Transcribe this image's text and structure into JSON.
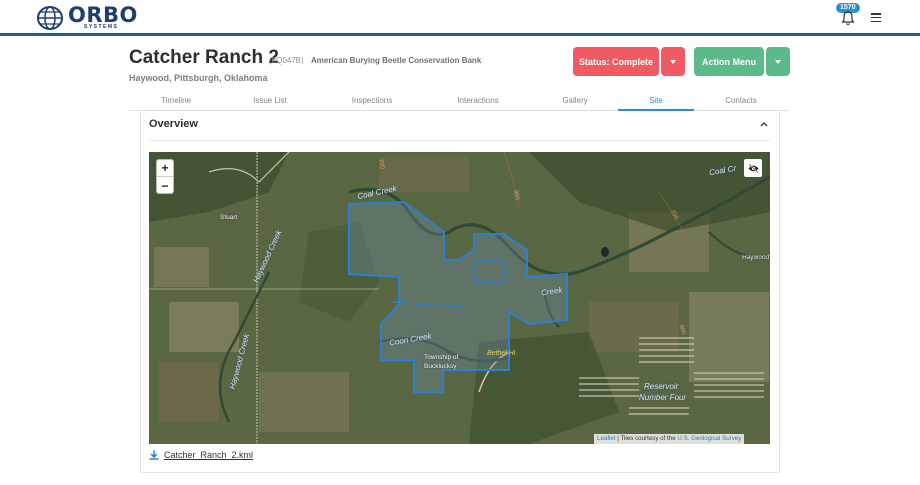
{
  "header": {
    "logo_text": "ORBO",
    "logo_subtext": "SYSTEMS",
    "notification_count": "1570",
    "icons": [
      "globe-logo-icon",
      "bell-icon",
      "hamburger-menu-icon"
    ]
  },
  "project": {
    "title": "Catcher Ranch 2",
    "code": "(8Q047B)",
    "bank": "American Burying Beetle Conservation Bank",
    "location": "Haywood, Pittsburgh, Oklahoma"
  },
  "buttons": {
    "status_label": "Status: Complete",
    "action_label": "Action Menu"
  },
  "tabs": [
    {
      "label": "Timeline",
      "active": false
    },
    {
      "label": "Issue List",
      "active": false
    },
    {
      "label": "Inspections",
      "active": false
    },
    {
      "label": "Interactions",
      "active": false
    },
    {
      "label": "Gallery",
      "active": false
    },
    {
      "label": "Site",
      "active": true
    },
    {
      "label": "Contacts",
      "active": false
    }
  ],
  "overview": {
    "title": "Overview",
    "zoom_in": "+",
    "zoom_out": "−",
    "map_labels": {
      "coal_creek_1": "Coal Creek",
      "coal_creek_2": "Coal Cr",
      "creek_right": "Creek",
      "haywood_creek_1": "Haywood Creek",
      "haywood_creek_2": "Haywood Creek",
      "coon_creek": "Coon Creek",
      "stuart": "Stuart",
      "haywood": "Haywood",
      "township_1": "Township of",
      "township_2": "Bucklucksy",
      "bethel_hill": "Bethel Hi",
      "reservoir_1": "Reservoir",
      "reservoir_2": "Number Four",
      "contour_a": "700",
      "contour_b": "700",
      "contour_c": "800",
      "contour_d": "900"
    },
    "attribution_leaflet": "Leaflet",
    "attribution_mid": " | Tiles courtesy of the ",
    "attribution_source": "U.S. Geological Survey",
    "kml_file": "Catcher_Ranch_2.kml"
  },
  "colors": {
    "brand": "#1d3e6e",
    "status": "#f05a63",
    "action": "#5cb98a",
    "accent": "#2b8fd6",
    "parcel_outline": "#2f7fd0"
  }
}
